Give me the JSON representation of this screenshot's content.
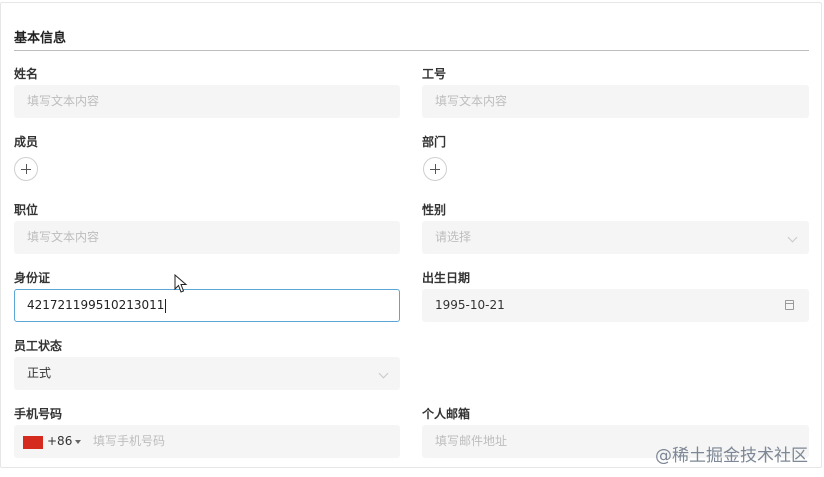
{
  "section": {
    "title": "基本信息"
  },
  "fields": {
    "name": {
      "label": "姓名",
      "placeholder": "填写文本内容"
    },
    "employee_id": {
      "label": "工号",
      "placeholder": "填写文本内容"
    },
    "member": {
      "label": "成员"
    },
    "department": {
      "label": "部门"
    },
    "position": {
      "label": "职位",
      "placeholder": "填写文本内容"
    },
    "gender": {
      "label": "性别",
      "placeholder": "请选择"
    },
    "id_card": {
      "label": "身份证",
      "value": "421721199510213011"
    },
    "birth_date": {
      "label": "出生日期",
      "value": "1995-10-21"
    },
    "status": {
      "label": "员工状态",
      "value": "正式"
    },
    "phone": {
      "label": "手机号码",
      "country_code": "+86",
      "placeholder": "填写手机号码"
    },
    "email": {
      "label": "个人邮箱",
      "placeholder": "填写邮件地址"
    }
  },
  "icons": {
    "add": "plus-icon",
    "select": "chevron-down-icon",
    "date": "calendar-icon",
    "flag": "china-flag-icon"
  },
  "colors": {
    "field_bg": "#f5f5f5",
    "active_border": "#5aa6d6",
    "placeholder": "#bdbdbd",
    "flag": "#d52b1e"
  },
  "watermark": "@稀土掘金技术社区"
}
